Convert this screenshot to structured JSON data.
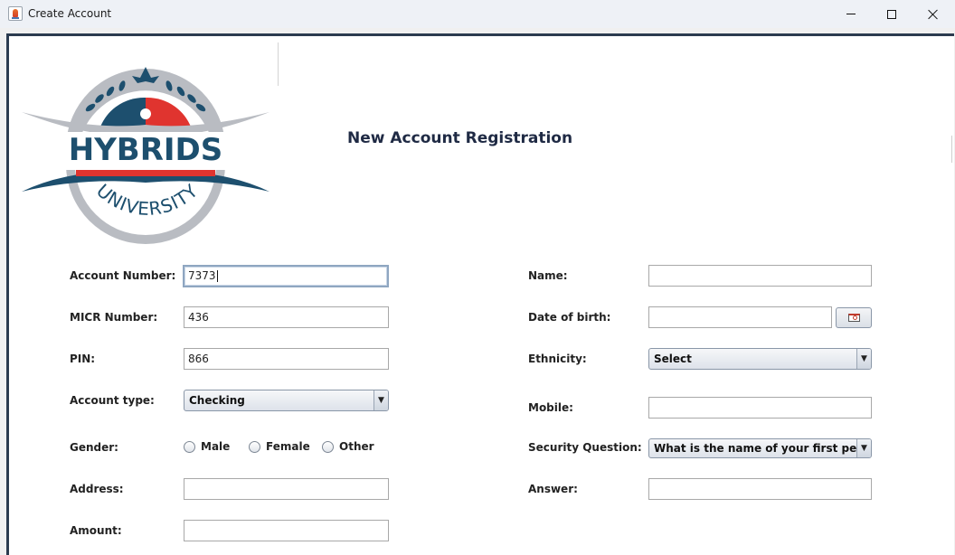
{
  "window": {
    "title": "Create Account",
    "icon": "java-cup-icon",
    "controls": [
      "minimize-icon",
      "maximize-icon",
      "close-icon"
    ]
  },
  "logo": {
    "text_top": "HYBRIDS",
    "text_bottom": "UNIVERSITY",
    "colors": {
      "navy": "#1d4f6e",
      "red": "#e0342f",
      "grey": "#b9bcc2"
    }
  },
  "heading": "New Account Registration",
  "form": {
    "account_number": {
      "label": "Account Number:",
      "value": "7373"
    },
    "micr_number": {
      "label": "MICR Number:",
      "value": "436"
    },
    "pin": {
      "label": "PIN:",
      "value": "866"
    },
    "account_type": {
      "label": "Account type:",
      "selected": "Checking"
    },
    "gender": {
      "label": "Gender:",
      "options": [
        "Male",
        "Female",
        "Other"
      ]
    },
    "address": {
      "label": "Address:",
      "value": ""
    },
    "amount": {
      "label": "Amount:",
      "value": ""
    },
    "name": {
      "label": "Name:",
      "value": ""
    },
    "dob": {
      "label": "Date of birth:",
      "value": "",
      "button_icon": "calendar-icon"
    },
    "ethnicity": {
      "label": "Ethnicity:",
      "selected": "Select"
    },
    "mobile": {
      "label": "Mobile:",
      "value": ""
    },
    "security_question": {
      "label": "Security Question:",
      "selected": "What is the name of your first pet?"
    },
    "answer": {
      "label": "Answer:",
      "value": ""
    }
  }
}
